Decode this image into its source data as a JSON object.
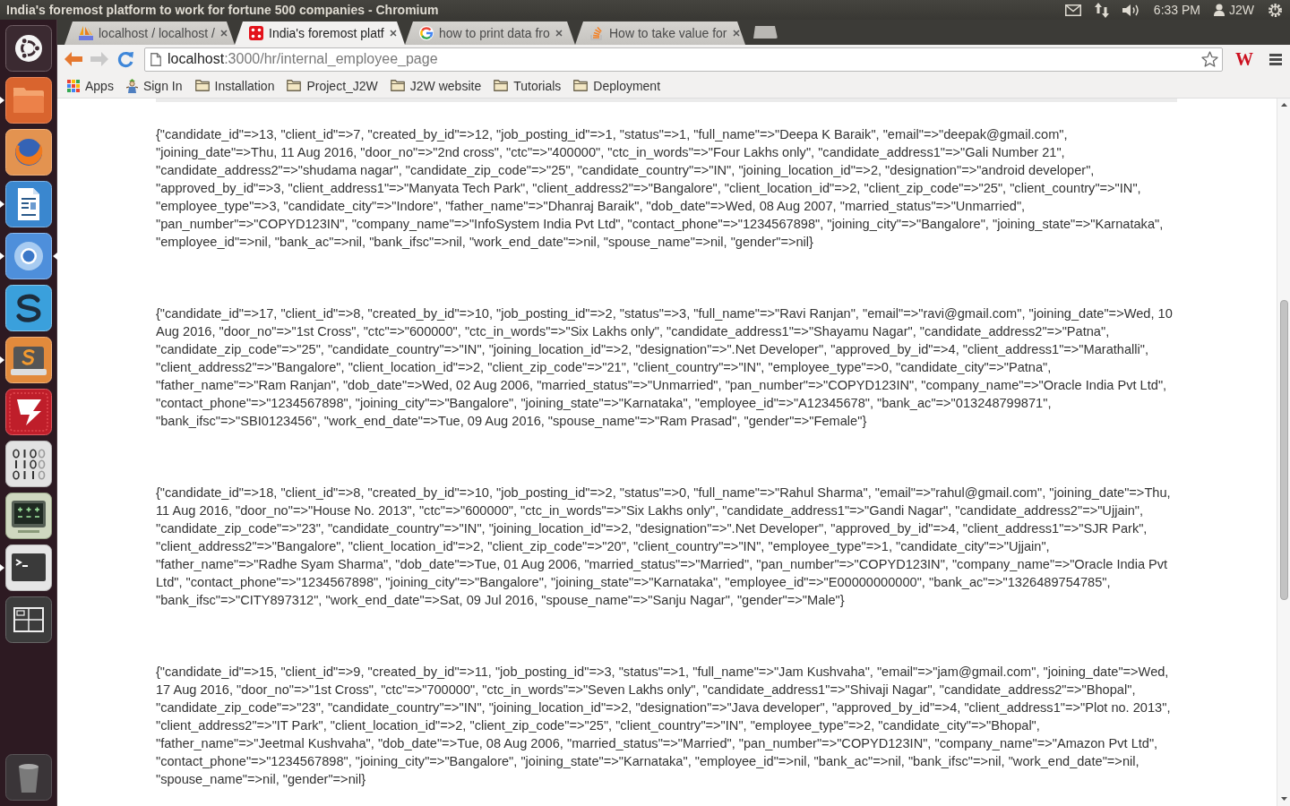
{
  "top_panel": {
    "title": "India's foremost platform to work for fortune 500 companies - Chromium",
    "clock": "6:33 PM",
    "user": "J2W"
  },
  "launcher": {
    "items": [
      {
        "kind": "dash",
        "running": false,
        "focused": false
      },
      {
        "kind": "files",
        "running": true,
        "focused": false
      },
      {
        "kind": "browser",
        "running": false,
        "focused": false
      },
      {
        "kind": "writer",
        "running": true,
        "focused": false
      },
      {
        "kind": "chromium",
        "running": true,
        "focused": true
      },
      {
        "kind": "sync",
        "running": false,
        "focused": false
      },
      {
        "kind": "editor",
        "running": true,
        "focused": false
      },
      {
        "kind": "ftp",
        "running": false,
        "focused": false
      },
      {
        "kind": "binary",
        "running": false,
        "focused": false
      },
      {
        "kind": "monitor",
        "running": false,
        "focused": false
      },
      {
        "kind": "terminal",
        "running": true,
        "focused": false
      },
      {
        "kind": "workspaces",
        "running": false,
        "focused": false
      },
      {
        "kind": "trash",
        "running": false,
        "focused": false
      }
    ]
  },
  "tabs": [
    {
      "kind": "sails",
      "title": "localhost / localhost /",
      "selected": false
    },
    {
      "kind": "dice",
      "title": "India's foremost platf",
      "selected": true
    },
    {
      "kind": "google",
      "title": "how to print data fro",
      "selected": false
    },
    {
      "kind": "stack",
      "title": "How to take value for",
      "selected": false
    }
  ],
  "toolbar": {
    "nav_buttons": [
      {
        "kind": "back",
        "disabled": false
      },
      {
        "kind": "forward",
        "disabled": true
      },
      {
        "kind": "reload",
        "disabled": false
      }
    ],
    "address": {
      "host": "localhost",
      "path": ":3000/hr/internal_employee_page"
    },
    "extension_label": "W"
  },
  "bookmarks": [
    {
      "kind": "apps",
      "label": "Apps"
    },
    {
      "kind": "site",
      "label": "Sign In"
    },
    {
      "kind": "folder",
      "label": "Installation"
    },
    {
      "kind": "folder",
      "label": "Project_J2W"
    },
    {
      "kind": "folder",
      "label": "J2W website"
    },
    {
      "kind": "folder",
      "label": "Tutorials"
    },
    {
      "kind": "folder",
      "label": "Deployment"
    }
  ],
  "records": [
    "{\"candidate_id\"=>13, \"client_id\"=>7, \"created_by_id\"=>12, \"job_posting_id\"=>1, \"status\"=>1, \"full_name\"=>\"Deepa K Baraik\", \"email\"=>\"deepak@gmail.com\", \"joining_date\"=>Thu, 11 Aug 2016, \"door_no\"=>\"2nd cross\", \"ctc\"=>\"400000\", \"ctc_in_words\"=>\"Four Lakhs only\", \"candidate_address1\"=>\"Gali Number 21\", \"candidate_address2\"=>\"shudama nagar\", \"candidate_zip_code\"=>\"25\", \"candidate_country\"=>\"IN\", \"joining_location_id\"=>2, \"designation\"=>\"android developer\", \"approved_by_id\"=>3, \"client_address1\"=>\"Manyata Tech Park\", \"client_address2\"=>\"Bangalore\", \"client_location_id\"=>2, \"client_zip_code\"=>\"25\", \"client_country\"=>\"IN\", \"employee_type\"=>3, \"candidate_city\"=>\"Indore\", \"father_name\"=>\"Dhanraj Baraik\", \"dob_date\"=>Wed, 08 Aug 2007, \"married_status\"=>\"Unmarried\", \"pan_number\"=>\"COPYD123IN\", \"company_name\"=>\"InfoSystem India Pvt Ltd\", \"contact_phone\"=>\"1234567898\", \"joining_city\"=>\"Bangalore\", \"joining_state\"=>\"Karnataka\", \"employee_id\"=>nil, \"bank_ac\"=>nil, \"bank_ifsc\"=>nil, \"work_end_date\"=>nil, \"spouse_name\"=>nil, \"gender\"=>nil}",
    "{\"candidate_id\"=>17, \"client_id\"=>8, \"created_by_id\"=>10, \"job_posting_id\"=>2, \"status\"=>3, \"full_name\"=>\"Ravi Ranjan\", \"email\"=>\"ravi@gmail.com\", \"joining_date\"=>Wed, 10 Aug 2016, \"door_no\"=>\"1st Cross\", \"ctc\"=>\"600000\", \"ctc_in_words\"=>\"Six Lakhs only\", \"candidate_address1\"=>\"Shayamu Nagar\", \"candidate_address2\"=>\"Patna\", \"candidate_zip_code\"=>\"25\", \"candidate_country\"=>\"IN\", \"joining_location_id\"=>2, \"designation\"=>\".Net Developer\", \"approved_by_id\"=>4, \"client_address1\"=>\"Marathalli\", \"client_address2\"=>\"Bangalore\", \"client_location_id\"=>2, \"client_zip_code\"=>\"21\", \"client_country\"=>\"IN\", \"employee_type\"=>0, \"candidate_city\"=>\"Patna\", \"father_name\"=>\"Ram Ranjan\", \"dob_date\"=>Wed, 02 Aug 2006, \"married_status\"=>\"Unmarried\", \"pan_number\"=>\"COPYD123IN\", \"company_name\"=>\"Oracle India Pvt Ltd\", \"contact_phone\"=>\"1234567898\", \"joining_city\"=>\"Bangalore\", \"joining_state\"=>\"Karnataka\", \"employee_id\"=>\"A12345678\", \"bank_ac\"=>\"013248799871\", \"bank_ifsc\"=>\"SBI0123456\", \"work_end_date\"=>Tue, 09 Aug 2016, \"spouse_name\"=>\"Ram Prasad\", \"gender\"=>\"Female\"}",
    "{\"candidate_id\"=>18, \"client_id\"=>8, \"created_by_id\"=>10, \"job_posting_id\"=>2, \"status\"=>0, \"full_name\"=>\"Rahul Sharma\", \"email\"=>\"rahul@gmail.com\", \"joining_date\"=>Thu, 11 Aug 2016, \"door_no\"=>\"House No. 2013\", \"ctc\"=>\"600000\", \"ctc_in_words\"=>\"Six Lakhs only\", \"candidate_address1\"=>\"Gandi Nagar\", \"candidate_address2\"=>\"Ujjain\", \"candidate_zip_code\"=>\"23\", \"candidate_country\"=>\"IN\", \"joining_location_id\"=>2, \"designation\"=>\".Net Developer\", \"approved_by_id\"=>4, \"client_address1\"=>\"SJR Park\", \"client_address2\"=>\"Bangalore\", \"client_location_id\"=>2, \"client_zip_code\"=>\"20\", \"client_country\"=>\"IN\", \"employee_type\"=>1, \"candidate_city\"=>\"Ujjain\", \"father_name\"=>\"Radhe Syam Sharma\", \"dob_date\"=>Tue, 01 Aug 2006, \"married_status\"=>\"Married\", \"pan_number\"=>\"COPYD123IN\", \"company_name\"=>\"Oracle India Pvt Ltd\", \"contact_phone\"=>\"1234567898\", \"joining_city\"=>\"Bangalore\", \"joining_state\"=>\"Karnataka\", \"employee_id\"=>\"E00000000000\", \"bank_ac\"=>\"1326489754785\", \"bank_ifsc\"=>\"CITY897312\", \"work_end_date\"=>Sat, 09 Jul 2016, \"spouse_name\"=>\"Sanju Nagar\", \"gender\"=>\"Male\"}",
    "{\"candidate_id\"=>15, \"client_id\"=>9, \"created_by_id\"=>11, \"job_posting_id\"=>3, \"status\"=>1, \"full_name\"=>\"Jam Kushvaha\", \"email\"=>\"jam@gmail.com\", \"joining_date\"=>Wed, 17 Aug 2016, \"door_no\"=>\"1st Cross\", \"ctc\"=>\"700000\", \"ctc_in_words\"=>\"Seven Lakhs only\", \"candidate_address1\"=>\"Shivaji Nagar\", \"candidate_address2\"=>\"Bhopal\", \"candidate_zip_code\"=>\"23\", \"candidate_country\"=>\"IN\", \"joining_location_id\"=>2, \"designation\"=>\"Java developer\", \"approved_by_id\"=>4, \"client_address1\"=>\"Plot no. 2013\", \"client_address2\"=>\"IT Park\", \"client_location_id\"=>2, \"client_zip_code\"=>\"25\", \"client_country\"=>\"IN\", \"employee_type\"=>2, \"candidate_city\"=>\"Bhopal\", \"father_name\"=>\"Jeetmal Kushvaha\", \"dob_date\"=>Tue, 08 Aug 2006, \"married_status\"=>\"Married\", \"pan_number\"=>\"COPYD123IN\", \"company_name\"=>\"Amazon Pvt Ltd\", \"contact_phone\"=>\"1234567898\", \"joining_city\"=>\"Bangalore\", \"joining_state\"=>\"Karnataka\", \"employee_id\"=>nil, \"bank_ac\"=>nil, \"bank_ifsc\"=>nil, \"work_end_date\"=>nil, \"spouse_name\"=>nil, \"gender\"=>nil}"
  ]
}
